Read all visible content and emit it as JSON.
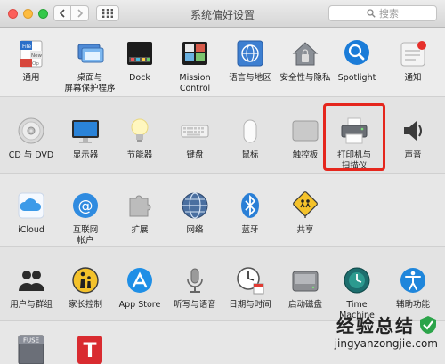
{
  "window": {
    "title": "系统偏好设置"
  },
  "search": {
    "placeholder": "搜索"
  },
  "rows": {
    "personal": [
      {
        "label": "通用",
        "icon": "general-file-icon"
      },
      {
        "label": "桌面与\n屏幕保护程序",
        "icon": "desktop-screensaver-icon"
      },
      {
        "label": "Dock",
        "icon": "dock-icon"
      },
      {
        "label": "Mission\nControl",
        "icon": "mission-control-icon"
      },
      {
        "label": "语言与地区",
        "icon": "language-region-icon"
      },
      {
        "label": "安全性与隐私",
        "icon": "security-house-icon"
      },
      {
        "label": "Spotlight",
        "icon": "spotlight-search-icon"
      },
      {
        "label": "通知",
        "icon": "notifications-icon"
      }
    ],
    "hardware": [
      {
        "label": "CD 与 DVD",
        "icon": "cd-dvd-icon"
      },
      {
        "label": "显示器",
        "icon": "display-monitor-icon"
      },
      {
        "label": "节能器",
        "icon": "energy-saver-bulb-icon"
      },
      {
        "label": "键盘",
        "icon": "keyboard-icon"
      },
      {
        "label": "鼠标",
        "icon": "mouse-icon"
      },
      {
        "label": "触控板",
        "icon": "trackpad-icon"
      },
      {
        "label": "打印机与\n扫描仪",
        "icon": "printer-scanner-icon"
      },
      {
        "label": "声音",
        "icon": "sound-speaker-icon"
      }
    ],
    "internet": [
      {
        "label": "iCloud",
        "icon": "icloud-icon"
      },
      {
        "label": "互联网\n帐户",
        "icon": "internet-accounts-icon"
      },
      {
        "label": "扩展",
        "icon": "extensions-puzzle-icon"
      },
      {
        "label": "网络",
        "icon": "network-globe-icon"
      },
      {
        "label": "蓝牙",
        "icon": "bluetooth-icon"
      },
      {
        "label": "共享",
        "icon": "sharing-sign-icon"
      }
    ],
    "system": [
      {
        "label": "用户与群组",
        "icon": "users-groups-icon"
      },
      {
        "label": "家长控制",
        "icon": "parental-controls-icon"
      },
      {
        "label": "App Store",
        "icon": "app-store-icon"
      },
      {
        "label": "听写与语音",
        "icon": "dictation-microphone-icon"
      },
      {
        "label": "日期与时间",
        "icon": "date-time-clock-icon"
      },
      {
        "label": "启动磁盘",
        "icon": "startup-disk-icon"
      },
      {
        "label": "Time Machine",
        "icon": "time-machine-icon"
      },
      {
        "label": "辅助功能",
        "icon": "accessibility-icon"
      }
    ],
    "other_visible_icons": [
      "fuse-icon",
      "tuxera-t-icon"
    ],
    "other_icon_text": {
      "fuse": "FUSE",
      "tuxera": "T"
    }
  },
  "watermark": {
    "title": "经验总结",
    "url": "jingyanzongjie.com"
  },
  "colors": {
    "highlight": "#e5261d"
  }
}
